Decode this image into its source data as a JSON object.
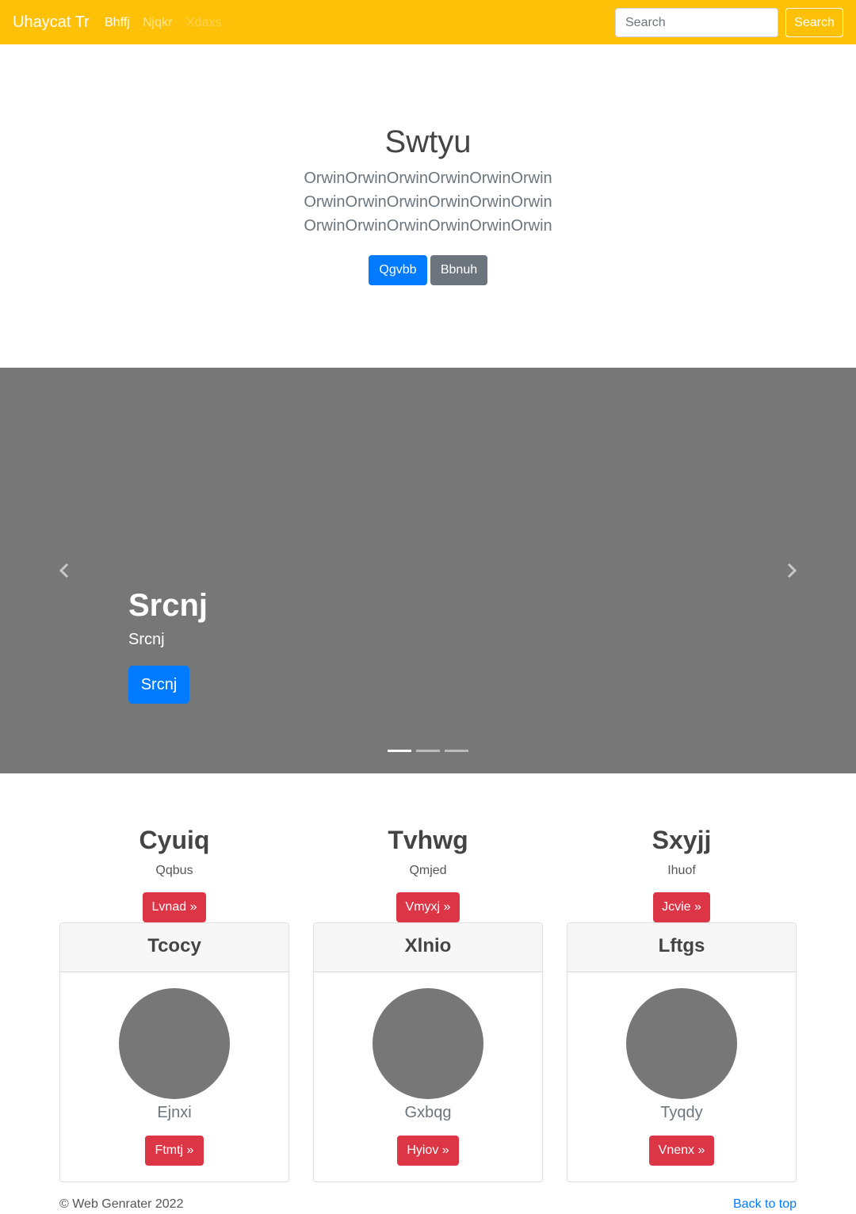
{
  "navbar": {
    "brand": "Uhaycat Tr",
    "links": [
      "Bhffj",
      "Njqkr",
      "Xdaxs"
    ],
    "search_placeholder": "Search",
    "search_button": "Search",
    "color": "#ffc107"
  },
  "hero": {
    "title": "Swtyu",
    "lead_lines": [
      "OrwinOrwinOrwinOrwinOrwinOrwin",
      "OrwinOrwinOrwinOrwinOrwinOrwin",
      "OrwinOrwinOrwinOrwinOrwinOrwin"
    ],
    "primary_button": "Qgvbb",
    "secondary_button": "Bbnuh"
  },
  "carousel": {
    "title": "Srcnj",
    "text": "Srcnj",
    "button": "Srcnj",
    "prev_icon": "chevron-left-icon",
    "next_icon": "chevron-right-icon",
    "slide_count": 3,
    "active_slide": 1
  },
  "features": [
    {
      "title": "Cyuiq",
      "text": "Qqbus",
      "button": "Lvnad »"
    },
    {
      "title": "Tvhwg",
      "text": "Qmjed",
      "button": "Vmyxj »"
    },
    {
      "title": "Sxyjj",
      "text": "Ihuof",
      "button": "Jcvie »"
    }
  ],
  "cards": [
    {
      "header": "Tcocy",
      "name": "Ejnxi",
      "button": "Ftmtj »"
    },
    {
      "header": "Xlnio",
      "name": "Gxbqg",
      "button": "Hyiov »"
    },
    {
      "header": "Lftgs",
      "name": "Tyqdy",
      "button": "Vnenx »"
    }
  ],
  "footer": {
    "copyright": "© Web Genrater 2022",
    "back_to_top": "Back to top"
  }
}
